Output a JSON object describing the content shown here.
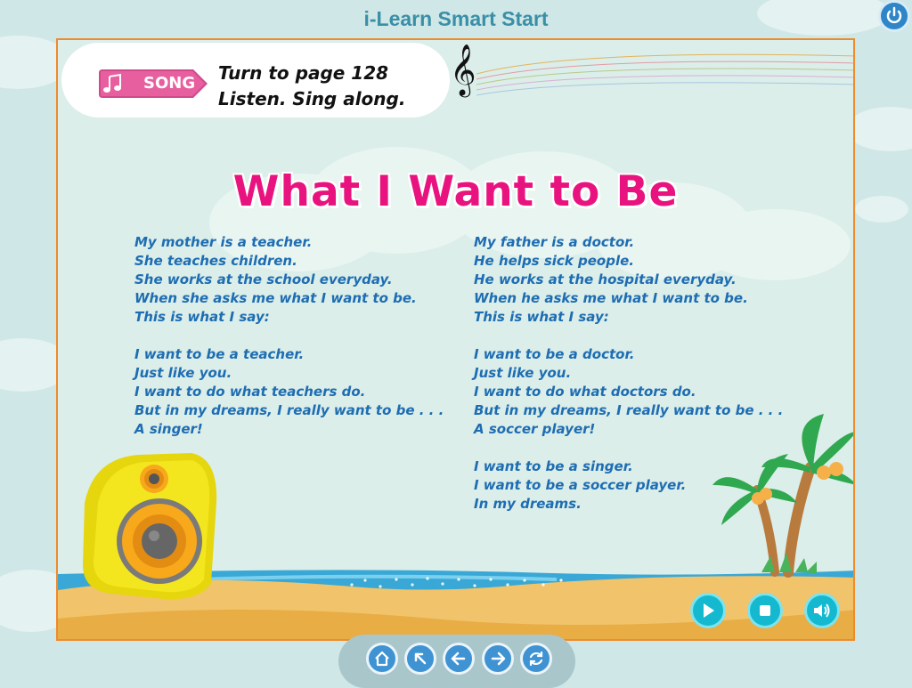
{
  "app": {
    "title": "i-Learn Smart Start"
  },
  "header": {
    "tag_label": "SONG",
    "instruction_line1": "Turn to page 128",
    "instruction_line2": "Listen. Sing along."
  },
  "song": {
    "title": "What I Want to Be",
    "left_stanzas": [
      [
        "My mother is a teacher.",
        "She teaches children.",
        "She works at the school everyday.",
        "When she asks me what I want to be.",
        "This is what I say:"
      ],
      [
        "I want to be a teacher.",
        "Just like you.",
        "I want to do what teachers do.",
        "But in my dreams, I really want to be . . .",
        "A singer!"
      ]
    ],
    "right_stanzas": [
      [
        "My father is a doctor.",
        "He helps sick people.",
        "He works at the hospital everyday.",
        "When he asks me what I want to be.",
        "This is what I say:"
      ],
      [
        "I want to be a doctor.",
        "Just like you.",
        "I want to do what doctors do.",
        "But in my dreams, I really want to be . . .",
        "A soccer player!"
      ],
      [
        "I want to be a singer.",
        "I want to be a soccer player.",
        "In my dreams."
      ]
    ]
  },
  "controls": {
    "icons": [
      "play-icon",
      "stop-icon",
      "volume-icon"
    ]
  },
  "navigation": {
    "icons": [
      "home-icon",
      "up-left-arrow-icon",
      "back-arrow-icon",
      "forward-arrow-icon",
      "refresh-icon"
    ]
  },
  "colors": {
    "title_pink": "#e8137f",
    "lyrics_blue": "#1e6db2",
    "frame_orange": "#f08a2b",
    "control_cyan": "#14b9d0",
    "nav_blue": "#3f93d3"
  }
}
